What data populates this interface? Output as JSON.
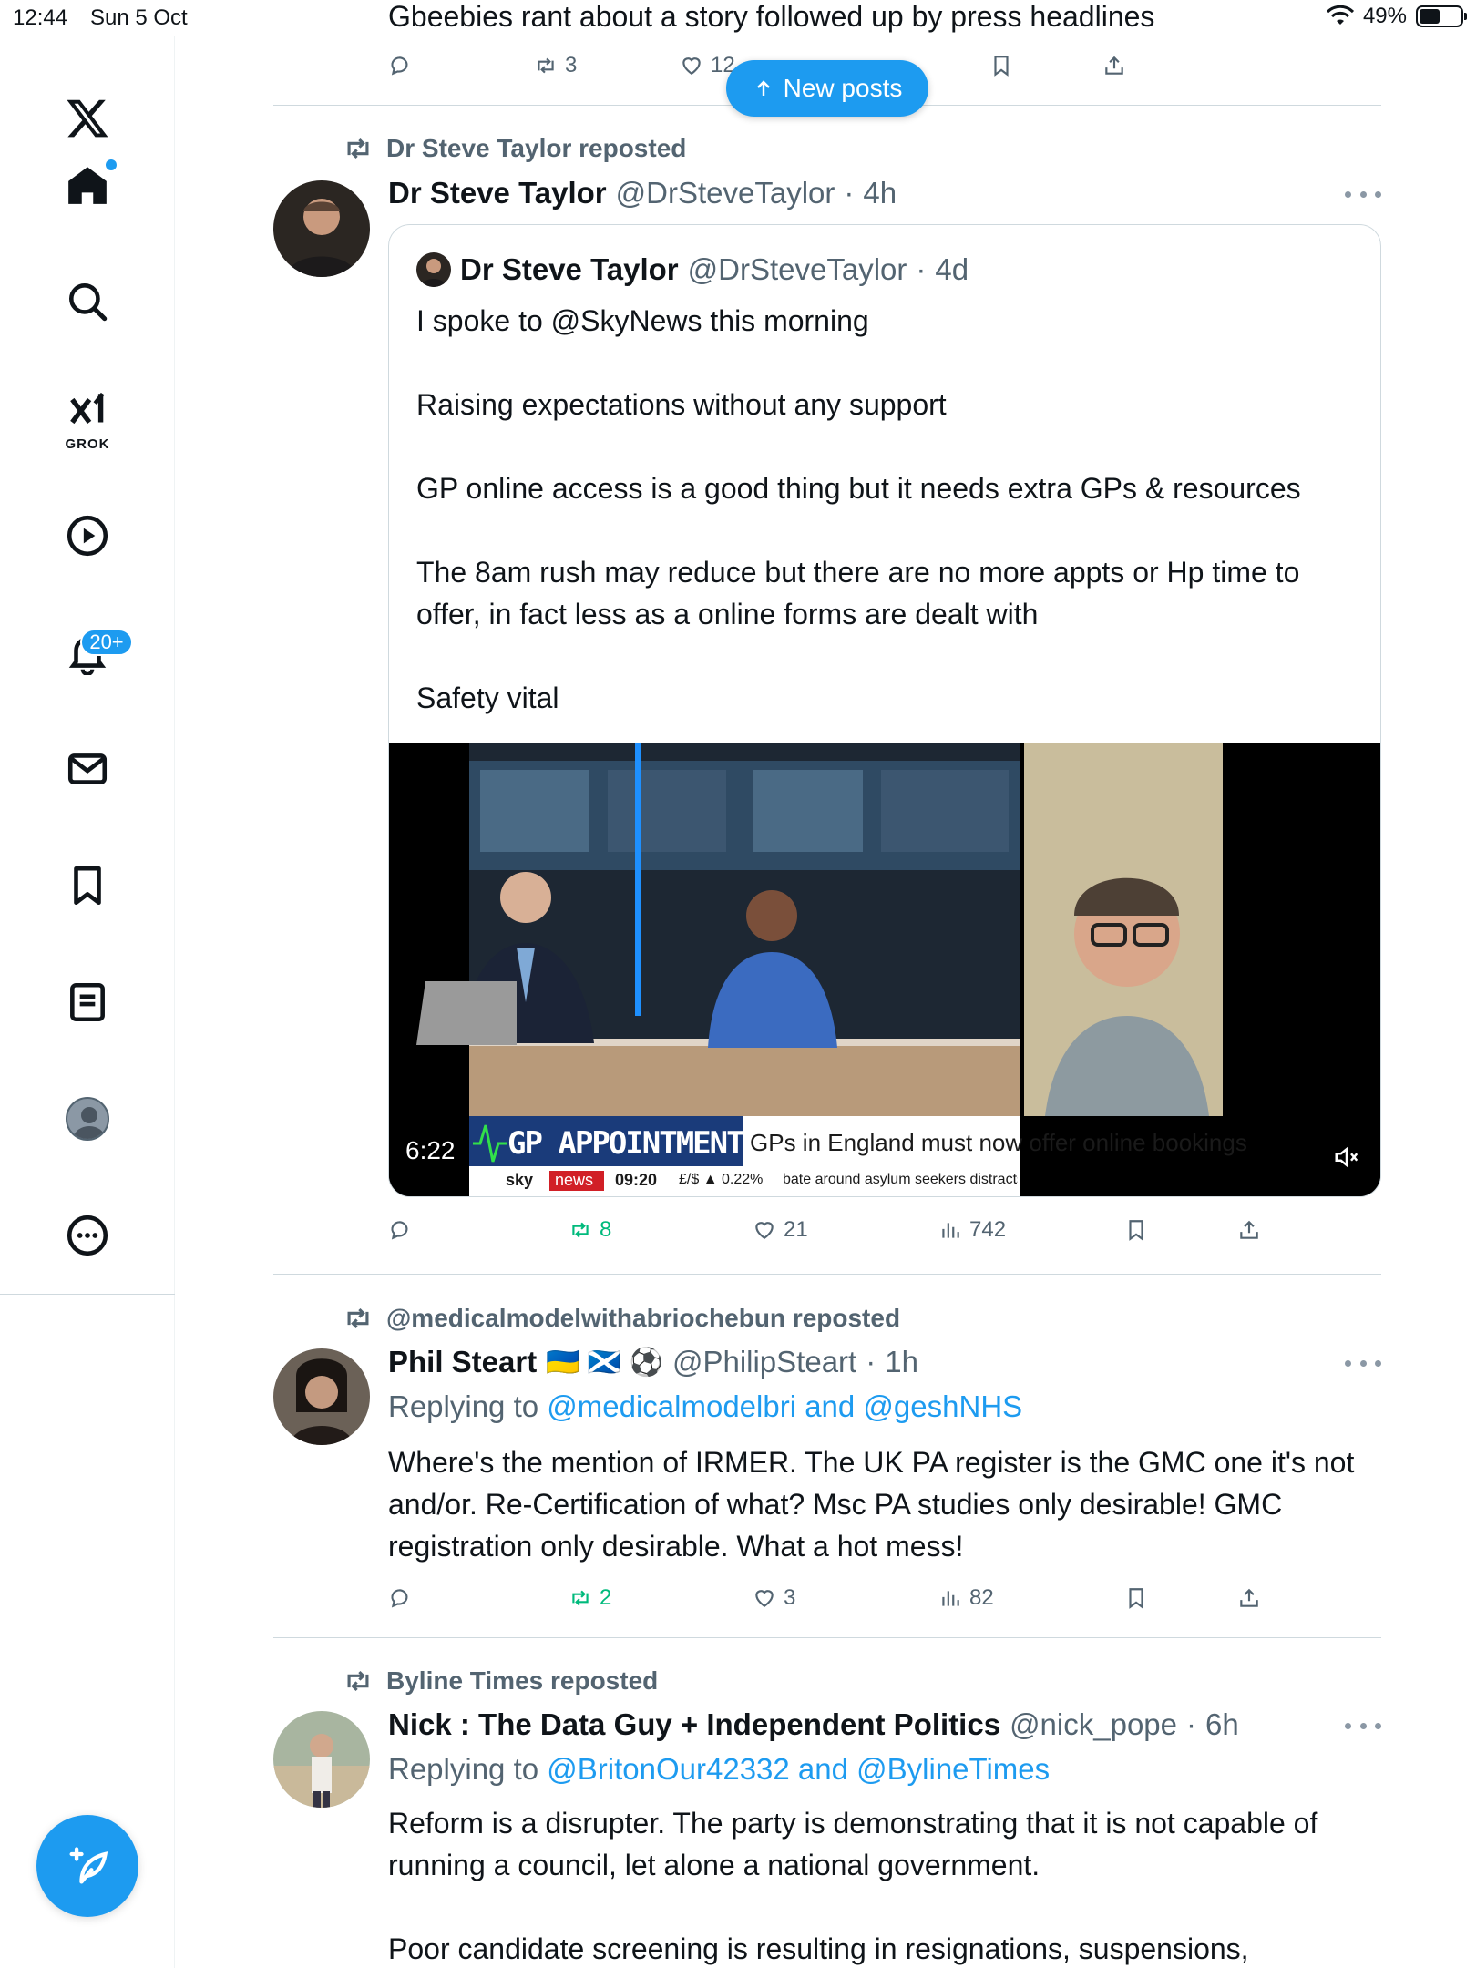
{
  "status": {
    "time": "12:44",
    "date": "Sun 5 Oct",
    "battery": "49%",
    "battery_level": 0.49
  },
  "sidebar": {
    "grok_label": "GROK",
    "notifications_badge": "20+",
    "items": [
      "x-logo",
      "home",
      "search",
      "grok",
      "video",
      "notifications",
      "messages",
      "bookmarks",
      "lists",
      "profile",
      "more"
    ]
  },
  "new_posts": {
    "label": "New posts"
  },
  "prev_post": {
    "text": "Gbeebies rant about a story followed up by press headlines",
    "reposts": "3",
    "likes": "12"
  },
  "posts": [
    {
      "repost_by": "Dr Steve Taylor reposted",
      "name": "Dr Steve Taylor",
      "handle": "@DrSteveTaylor",
      "time": "4h",
      "quote": {
        "name": "Dr Steve Taylor",
        "handle": "@DrSteveTaylor",
        "time": "4d",
        "text": "I spoke to @SkyNews this morning\n\nRaising expectations without any support\n\nGP online access is a good thing but it needs extra GPs & resources\n\nThe 8am rush may reduce but there are no more appts or Hp time to offer, in fact less as a online forms are dealt with\n\nSafety vital",
        "video": {
          "duration": "6:22",
          "banner_title": "GP APPOINTMENTS",
          "banner_sub": "GPs in England must now offer online bookings",
          "ticker_brand": "sky",
          "ticker_news": "news",
          "ticker_time": "09:20",
          "ticker_fx": "£/$ ▲ 0.22%",
          "ticker_text": "bate around asylum seekers distracts from the \"overall threat\" to wome"
        }
      },
      "replies": "",
      "reposts": "8",
      "likes": "21",
      "views": "742"
    },
    {
      "repost_by": "@medicalmodelwithabriochebun reposted",
      "name": "Phil Steart",
      "flags": "🇺🇦 🏴󠁧󠁢󠁳󠁣󠁴󠁿 ⚽",
      "handle": "@PhilipSteart",
      "time": "1h",
      "replying_prefix": "Replying to ",
      "replying_to": "@medicalmodelbri and @geshNHS",
      "text": "Where's the mention of IRMER. The UK PA register is the GMC one it's not and/or. Re-Certification of what? Msc PA studies only desirable! GMC registration only desirable. What a hot mess!",
      "reposts": "2",
      "likes": "3",
      "views": "82"
    },
    {
      "repost_by": "Byline Times reposted",
      "name": "Nick : The Data Guy + Independent Politics",
      "handle": "@nick_pope",
      "time": "6h",
      "replying_prefix": "Replying to ",
      "replying_to": "@BritonOur42332 and @BylineTimes",
      "text": "Reform is a disrupter. The party is demonstrating that it is not capable of running a council, let alone a national government.\n\nPoor candidate screening is resulting in resignations, suspensions,"
    }
  ],
  "colors": {
    "accent": "#1d9bf0",
    "secondary_text": "#536471",
    "repost_green": "#00ba7c",
    "border": "#cfd9de"
  }
}
